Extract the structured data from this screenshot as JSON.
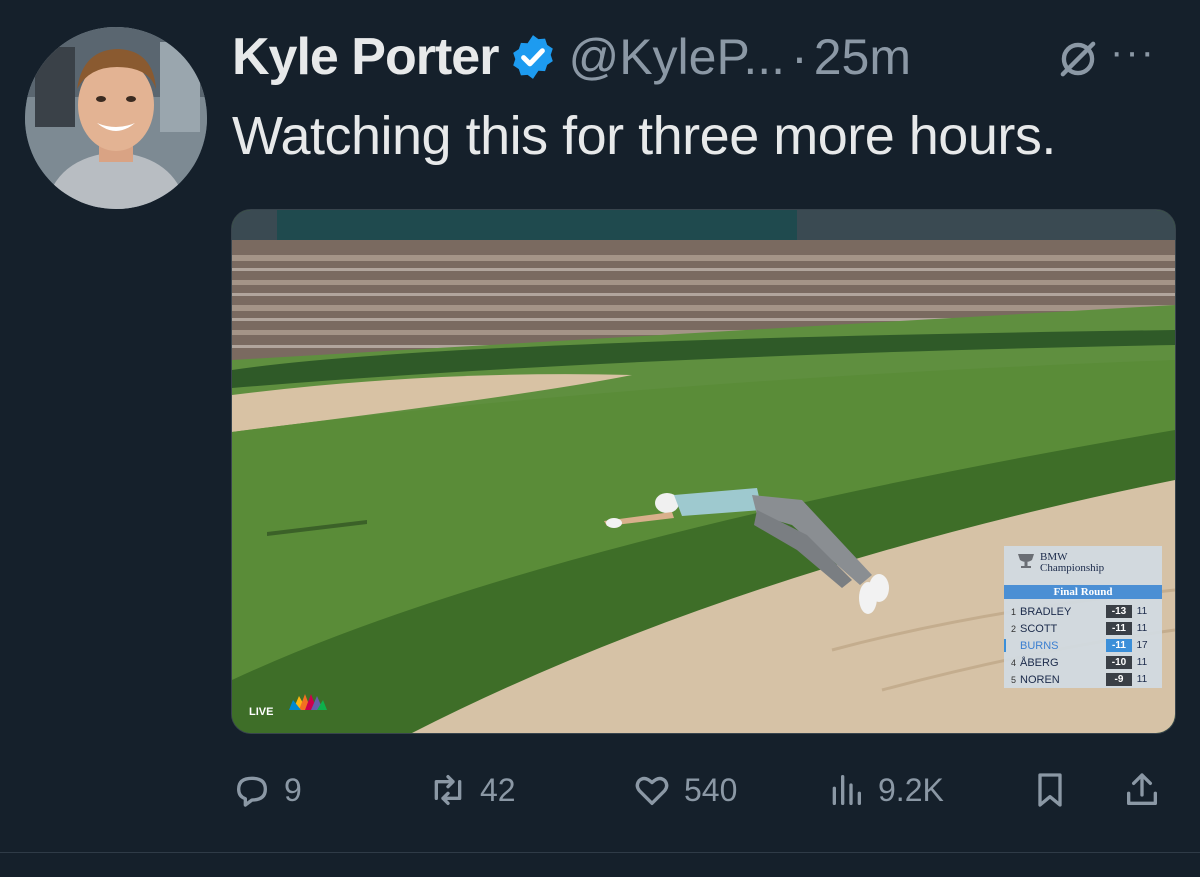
{
  "tweet": {
    "author_name": "Kyle Porter",
    "handle": "@KyleP...",
    "separator": "·",
    "time": "25m",
    "more": "···",
    "text": "Watching this for three more hours."
  },
  "media": {
    "live_label": "LIVE",
    "scoreboard": {
      "title_line1": "BMW",
      "title_line2": "Championship",
      "round": "Final Round",
      "rows": [
        {
          "pos": "1",
          "name": "BRADLEY",
          "score": "-13",
          "thru": "11"
        },
        {
          "pos": "2",
          "name": "SCOTT",
          "score": "-11",
          "thru": "11"
        },
        {
          "pos": "",
          "name": "BURNS",
          "score": "-11",
          "thru": "17"
        },
        {
          "pos": "4",
          "name": "ÅBERG",
          "score": "-10",
          "thru": "11"
        },
        {
          "pos": "5",
          "name": "NOREN",
          "score": "-9",
          "thru": "11"
        }
      ]
    }
  },
  "actions": {
    "replies": "9",
    "reposts": "42",
    "likes": "540",
    "views": "9.2K"
  },
  "colors": {
    "background": "#15202b",
    "verified": "#1d9bf0",
    "muted": "#8b98a5"
  }
}
